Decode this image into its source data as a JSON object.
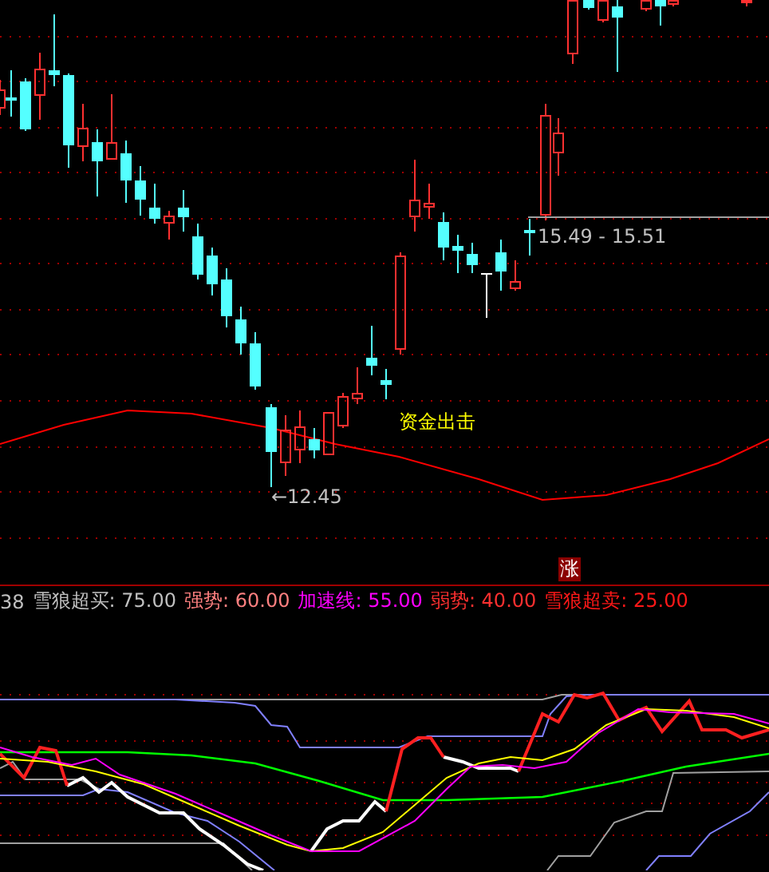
{
  "price_chart": {
    "annotations": [
      {
        "kind": "range",
        "text": "15.49 - 15.51"
      },
      {
        "kind": "low",
        "text": "←12.45"
      },
      {
        "kind": "signal",
        "text": "资金出击"
      }
    ],
    "badge": "涨"
  },
  "legend": [
    {
      "text": "38",
      "color": "#c0c0c0"
    },
    {
      "text": "雪狼超买: 75.00",
      "color": "#c0c0c0"
    },
    {
      "text": "强势: 60.00",
      "color": "#ff8080"
    },
    {
      "text": "加速线: 55.00",
      "color": "#ff00ff"
    },
    {
      "text": "弱势: 40.00",
      "color": "#ff3030"
    },
    {
      "text": "雪狼超卖: 25.00",
      "color": "#ff1818"
    }
  ]
}
